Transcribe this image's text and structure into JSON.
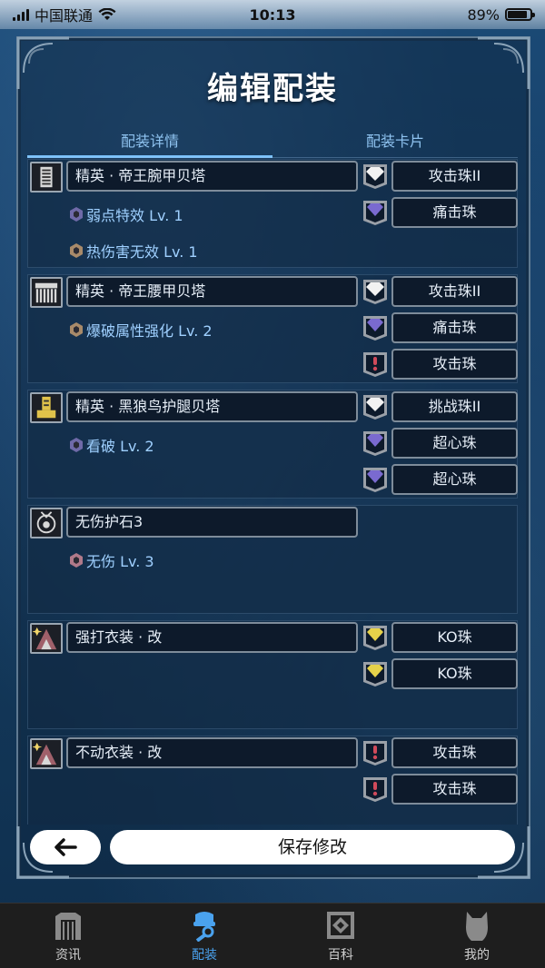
{
  "status": {
    "carrier": "中国联通",
    "time": "10:13",
    "battery": "89%",
    "battery_level": 0.89
  },
  "title": "编辑配装",
  "tabs": [
    {
      "label": "配装详情",
      "active": true
    },
    {
      "label": "配装卡片",
      "active": false
    }
  ],
  "equipment": [
    {
      "name": "精英 · 帝王腕甲贝塔",
      "icon": "arm-armor-icon",
      "skills": [
        {
          "label": "弱点特效 Lv. 1",
          "color": "#6f6aa8"
        },
        {
          "label": "热伤害无效 Lv. 1",
          "color": "#a88a6a"
        }
      ],
      "jewels": [
        {
          "slot": "slot-lv4-icon",
          "label": "攻击珠II"
        },
        {
          "slot": "slot-lv3-icon",
          "label": "痛击珠"
        }
      ]
    },
    {
      "name": "精英 · 帝王腰甲贝塔",
      "icon": "waist-armor-icon",
      "skills": [
        {
          "label": "爆破属性强化 Lv. 2",
          "color": "#a88a6a"
        }
      ],
      "jewels": [
        {
          "slot": "slot-lv4-icon",
          "label": "攻击珠II"
        },
        {
          "slot": "slot-lv3-icon",
          "label": "痛击珠"
        },
        {
          "slot": "slot-lv1-icon",
          "label": "攻击珠"
        }
      ]
    },
    {
      "name": "精英 · 黑狼鸟护腿贝塔",
      "icon": "leg-armor-icon",
      "skills": [
        {
          "label": "看破 Lv. 2",
          "color": "#6f6aa8"
        }
      ],
      "jewels": [
        {
          "slot": "slot-lv4-icon",
          "label": "挑战珠II"
        },
        {
          "slot": "slot-lv3-icon",
          "label": "超心珠"
        },
        {
          "slot": "slot-lv3-icon",
          "label": "超心珠"
        }
      ]
    },
    {
      "name": "无伤护石3",
      "icon": "charm-icon",
      "skills": [
        {
          "label": "无伤 Lv. 3",
          "color": "#b07a8a"
        }
      ],
      "jewels": []
    },
    {
      "name": "强打衣装 · 改",
      "icon": "mantle-icon",
      "skills": [],
      "jewels": [
        {
          "slot": "slot-lv2-icon",
          "label": "KO珠"
        },
        {
          "slot": "slot-lv2-icon",
          "label": "KO珠"
        }
      ]
    },
    {
      "name": "不动衣装 · 改",
      "icon": "mantle-icon",
      "skills": [],
      "jewels": [
        {
          "slot": "slot-lv1-icon",
          "label": "攻击珠"
        },
        {
          "slot": "slot-lv1-icon",
          "label": "攻击珠"
        }
      ]
    }
  ],
  "buttons": {
    "save": "保存修改"
  },
  "tabbar": [
    {
      "label": "资讯",
      "icon": "news-gate-icon",
      "active": false
    },
    {
      "label": "配装",
      "icon": "armor-set-icon",
      "active": true
    },
    {
      "label": "百科",
      "icon": "encyclopedia-icon",
      "active": false
    },
    {
      "label": "我的",
      "icon": "profile-cat-icon",
      "active": false
    }
  ],
  "colors": {
    "accent": "#4aa2ee",
    "tab_active": "#7cc3ff",
    "skill_text": "#9fd0ff"
  }
}
